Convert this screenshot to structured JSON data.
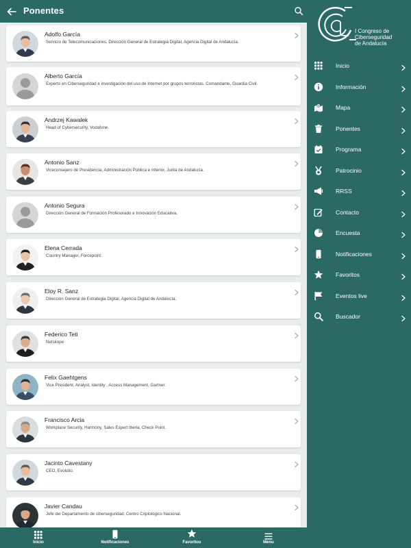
{
  "header": {
    "title": "Ponentes"
  },
  "speakers": [
    {
      "name": "Adolfo García",
      "desc": "Servicio de Telecomunicaciones, Dirección General de Estrategia Digital, Agencia Digital de Andalucía.",
      "avatar": "photo"
    },
    {
      "name": "Alberto García",
      "desc": "Experto en Ciberseguridad e investigación del uso de Internet por grupos terroristas. Comandante, Guardia Civil.",
      "avatar": "placeholder"
    },
    {
      "name": "Andrzej Kawalek",
      "desc": "Head of Cybersecurity, Vodafone.",
      "avatar": "photo"
    },
    {
      "name": "Antonio Sanz",
      "desc": "Viceconsejero de Presidencia, Administración Pública e Interior, Junta de Andalucía.",
      "avatar": "photo"
    },
    {
      "name": "Antonio Segura",
      "desc": "Dirección General de Formación Profesorado e Innovación Educativa.",
      "avatar": "placeholder"
    },
    {
      "name": "Elena Cerrada",
      "desc": "Country Manager, Forcepoint.",
      "avatar": "photo"
    },
    {
      "name": "Eloy R. Sanz",
      "desc": "Dirección General de Estrategia Digital, Agencia Digital de Andalucía.",
      "avatar": "photo"
    },
    {
      "name": "Federico Teti",
      "desc": "Netskope",
      "avatar": "photo"
    },
    {
      "name": "Felix Gaehtgens",
      "desc": "Vice President, Analyst, Identity , Access Management, Gartner.",
      "avatar": "photo"
    },
    {
      "name": "Francisco Arcia",
      "desc": "Workplace Security, Harmony, Sales Expert Iberia, Check Point.",
      "avatar": "photo"
    },
    {
      "name": "Jacinto Cavestany",
      "desc": "CEO, Evolutio.",
      "avatar": "photo"
    },
    {
      "name": "Javier Candau",
      "desc": "Jefe del Departamento de ciberseguridad, Centro Criptológico Nacional.",
      "avatar": "photo"
    }
  ],
  "bottom_nav": [
    {
      "label": "Inicio",
      "icon": "grid-icon"
    },
    {
      "label": "Notificaciones",
      "icon": "phone-icon"
    },
    {
      "label": "Favoritos",
      "icon": "star-icon"
    },
    {
      "label": "Menu",
      "icon": "hamburger-icon"
    }
  ],
  "logo": {
    "line1": "I Congreso de",
    "line2": "Ciberseguridad",
    "line3": "de Andalucía"
  },
  "menu": [
    {
      "label": "Inicio",
      "icon": "grid-icon"
    },
    {
      "label": "Información",
      "icon": "info-icon"
    },
    {
      "label": "Mapa",
      "icon": "map-icon"
    },
    {
      "label": "Ponentes",
      "icon": "trash-icon"
    },
    {
      "label": "Programa",
      "icon": "calendar-icon"
    },
    {
      "label": "Patrocinio",
      "icon": "medal-icon"
    },
    {
      "label": "RRSS",
      "icon": "megaphone-icon"
    },
    {
      "label": "Contacto",
      "icon": "edit-icon"
    },
    {
      "label": "Encuesta",
      "icon": "pie-icon"
    },
    {
      "label": "Notificaciones",
      "icon": "phone-icon"
    },
    {
      "label": "Favoritos",
      "icon": "star-icon"
    },
    {
      "label": "Eventos live",
      "icon": "flag-icon"
    },
    {
      "label": "Buscador",
      "icon": "search-icon"
    }
  ],
  "colors": {
    "primary": "#2a6a62",
    "background": "#e9ecec",
    "card": "#ffffff"
  }
}
